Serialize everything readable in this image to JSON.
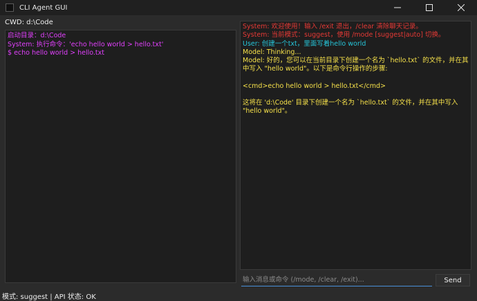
{
  "window": {
    "title": "CLI Agent GUI",
    "controls": [
      "minimize-icon",
      "maximize-icon",
      "close-icon"
    ]
  },
  "cwd": {
    "label": "CWD: d:\\Code"
  },
  "terminal": {
    "lines": [
      {
        "text": "启动目录：d:\\Code",
        "color": "#e040fb"
      },
      {
        "text": "System: 执行命令：'echo hello world > hello.txt'",
        "color": "#e040fb"
      },
      {
        "text": "$ echo hello world > hello.txt",
        "color": "#e040fb"
      }
    ]
  },
  "chat": {
    "lines": [
      {
        "text": "System: 欢迎使用！输入 /exit 退出，/clear 清除聊天记录。",
        "color": "#e53935"
      },
      {
        "text": "System: 当前模式：suggest，使用 /mode [suggest|auto] 切换。",
        "color": "#e53935"
      },
      {
        "text": "User: 创建一个txt，里面写着hello world",
        "color": "#26c6da"
      },
      {
        "text": "Model: Thinking...",
        "color": "#f5e04a"
      },
      {
        "text": "Model: 好的，您可以在当前目录下创建一个名为 `hello.txt` 的文件，并在其中写入 \"hello world\"。以下是命令行操作的步骤:",
        "color": "#f5e04a"
      },
      {
        "text": "",
        "color": "#f5e04a"
      },
      {
        "text": "<cmd>echo hello world > hello.txt</cmd>",
        "color": "#f5e04a"
      },
      {
        "text": "",
        "color": "#f5e04a"
      },
      {
        "text": "这将在 'd:\\Code' 目录下创建一个名为 `hello.txt` 的文件，并在其中写入 \"hello world\"。",
        "color": "#f5e04a"
      }
    ]
  },
  "input": {
    "placeholder": "输入消息或命令 (/mode, /clear, /exit)...",
    "value": ""
  },
  "send_button": {
    "label": "Send"
  },
  "status_bar": {
    "text": "模式: suggest | API 状态: OK"
  }
}
